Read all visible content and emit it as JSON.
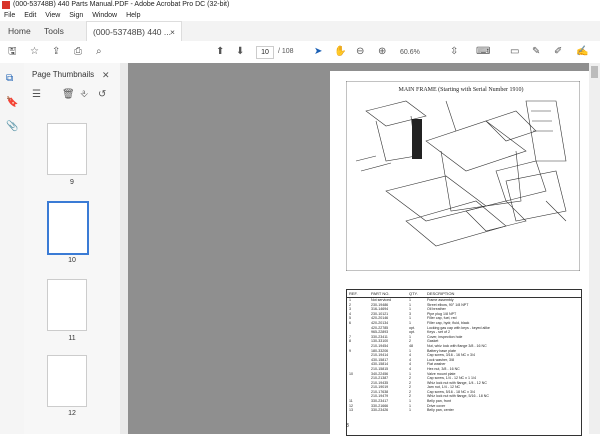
{
  "window_title": "(000-53748B) 440 Parts Manual.PDF - Adobe Acrobat Pro DC (32-bit)",
  "menu": [
    "File",
    "Edit",
    "View",
    "Sign",
    "Window",
    "Help"
  ],
  "tabs": {
    "home": "Home",
    "tools": "Tools",
    "doc": "(000-53748B) 440 ...",
    "close": "×"
  },
  "toolbar": {
    "page_current": "10",
    "page_total": "/ 108",
    "zoom": "60.6%"
  },
  "panel": {
    "title": "Page Thumbnails",
    "close": "✕"
  },
  "thumbs": [
    {
      "num": "9"
    },
    {
      "num": "10"
    },
    {
      "num": "11"
    },
    {
      "num": "12"
    }
  ],
  "doc": {
    "title": "MAIN FRAME (Starting with Serial Number 1910)",
    "table_header": {
      "ref": "REF.",
      "part": "PART NO.",
      "qty": "QTY.",
      "desc": "DESCRIPTION"
    },
    "rows": [
      [
        "1",
        "Not serviced",
        "1",
        "Frame assembly"
      ],
      [
        "2",
        "230-19486",
        "1",
        "Street elbow, 90° 1/8 NPT"
      ],
      [
        "3",
        "316-14694",
        "1",
        "Oil breather"
      ],
      [
        "4",
        "230-10121",
        "3",
        "Pipe plug 1/8 NPT"
      ],
      [
        "5",
        "420-20146",
        "1",
        "Filler cap, fuel, red"
      ],
      [
        "6",
        "420-20134",
        "1",
        "Filler cap, hydr, fluid, black"
      ],
      [
        "",
        "420-22785",
        "opt.",
        "Locking gas cap with keys - keyed alike"
      ],
      [
        "",
        "965-22893",
        "opt.",
        "Keys - set of 2"
      ],
      [
        "7",
        "330-23411",
        "1",
        "Cover, inspection hole"
      ],
      [
        "8",
        "130-33100",
        "2",
        "Gasket"
      ],
      [
        "",
        "210-19454",
        "48",
        "Nut, whiz lock with flange 3/8 - 16 NC"
      ],
      [
        "9",
        "180-33206",
        "1",
        "Battery base plate"
      ],
      [
        "",
        "210-19414",
        "4",
        "Cap screw, 3/16 - 16 NC x 3/4"
      ],
      [
        "",
        "430-15817",
        "4",
        "Lock washer, 3/8"
      ],
      [
        "",
        "430-15814",
        "4",
        "Flat washer"
      ],
      [
        "",
        "210-15815",
        "4",
        "Hex nut, 3/8 - 16 NC"
      ],
      [
        "10",
        "340-22456",
        "1",
        "Valve mount plate"
      ],
      [
        "",
        "210-21387",
        "2",
        "Cap screw, 1/4 - 12 NC x 1 1/4"
      ],
      [
        "",
        "210-19435",
        "2",
        "Whiz lock nut with flange, 1/4 - 12 NC"
      ],
      [
        "",
        "210-19019",
        "2",
        "Jam nut, 1/4 - 12 NC"
      ],
      [
        "",
        "210-17638",
        "2",
        "Cap screw, 5/16 - 18 NC x 3/4"
      ],
      [
        "",
        "210-19479",
        "2",
        "Whiz lock nut with flange, 5/16 - 18 NC"
      ],
      [
        "11",
        "330-23417",
        "1",
        "Belly pan, front"
      ],
      [
        "12",
        "330-21666",
        "1",
        "Drive cover"
      ],
      [
        "13",
        "330-23426",
        "1",
        "Belly pan, center"
      ]
    ],
    "footer": "8"
  }
}
